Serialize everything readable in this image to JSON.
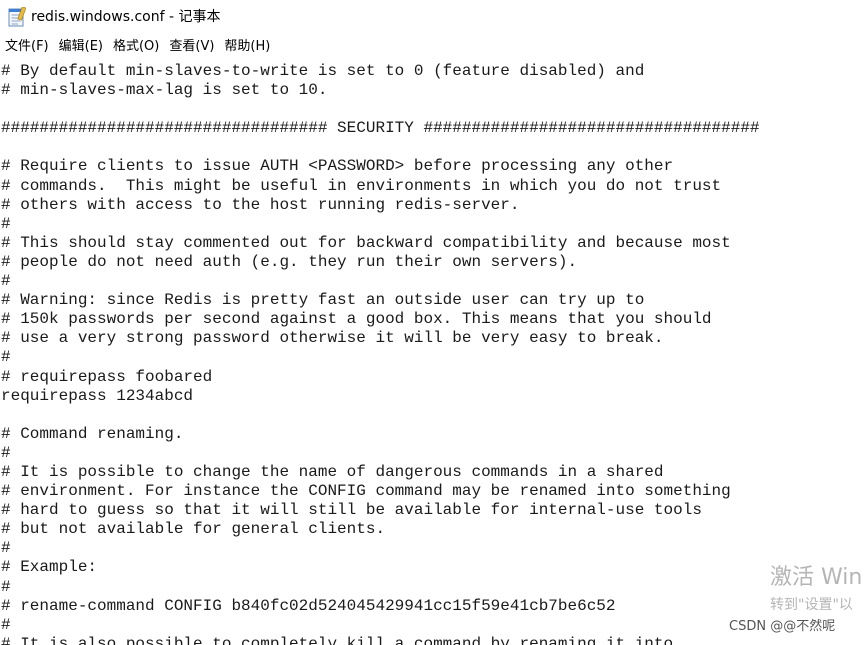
{
  "window": {
    "title": "redis.windows.conf - 记事本"
  },
  "menu": {
    "items": [
      "文件(F)",
      "编辑(E)",
      "格式(O)",
      "查看(V)",
      "帮助(H)"
    ]
  },
  "editor": {
    "lines": [
      "# By default min-slaves-to-write is set to 0 (feature disabled) and",
      "# min-slaves-max-lag is set to 10.",
      "",
      "################################## SECURITY ###################################",
      "",
      "# Require clients to issue AUTH <PASSWORD> before processing any other",
      "# commands.  This might be useful in environments in which you do not trust",
      "# others with access to the host running redis-server.",
      "#",
      "# This should stay commented out for backward compatibility and because most",
      "# people do not need auth (e.g. they run their own servers).",
      "#",
      "# Warning: since Redis is pretty fast an outside user can try up to",
      "# 150k passwords per second against a good box. This means that you should",
      "# use a very strong password otherwise it will be very easy to break.",
      "#",
      "# requirepass foobared",
      "requirepass 1234abcd",
      "",
      "# Command renaming.",
      "#",
      "# It is possible to change the name of dangerous commands in a shared",
      "# environment. For instance the CONFIG command may be renamed into something",
      "# hard to guess so that it will still be available for internal-use tools",
      "# but not available for general clients.",
      "#",
      "# Example:",
      "#",
      "# rename-command CONFIG b840fc02d524045429941cc15f59e41cb7be6c52",
      "#",
      "# It is also possible to completely kill a command by renaming it into"
    ]
  },
  "overlay": {
    "activation_title": "激活 Win",
    "activation_sub": "转到\"设置\"以",
    "csdn_mark": "CSDN @@不然呢"
  },
  "icons": {
    "app": "notepad-icon"
  }
}
